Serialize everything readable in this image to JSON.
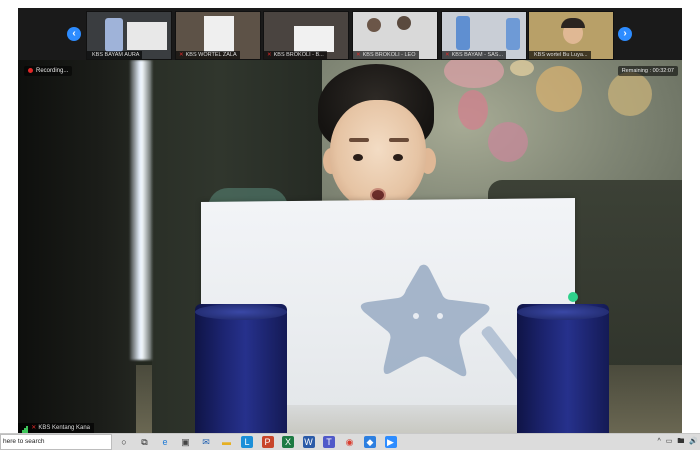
{
  "strip": {
    "prev_arrow": "‹",
    "next_arrow": "›",
    "thumbnails": [
      {
        "label": "KBS BAYAM AURA",
        "muted": false,
        "bg": "#3a3d40"
      },
      {
        "label": "KBS WORTEL ZALA",
        "muted": true,
        "bg": "#5d5247"
      },
      {
        "label": "KBS BROKOLI - B...",
        "muted": true,
        "bg": "#4a4440"
      },
      {
        "label": "KBS BROKOLI - LEO",
        "muted": true,
        "bg": "#d9d9d9"
      },
      {
        "label": "KBS BAYAM - SAS...",
        "muted": true,
        "bg": "#c9ced6"
      },
      {
        "label": "KBS wortel Bu Luya...",
        "muted": false,
        "bg": "#b8a068"
      }
    ]
  },
  "overlays": {
    "recording_label": "Recording...",
    "remaining_label": "Remaining : 00:32:07",
    "speaker_name": "KBS Kentang Kana"
  },
  "taskbar": {
    "search_text": "here to search",
    "icons": [
      {
        "name": "cortana-icon",
        "glyph": "○",
        "color": "#222"
      },
      {
        "name": "task-view-icon",
        "glyph": "⧉",
        "color": "#222"
      },
      {
        "name": "edge-icon",
        "glyph": "e",
        "color": "#1f7bd6"
      },
      {
        "name": "store-icon",
        "glyph": "▣",
        "color": "#444"
      },
      {
        "name": "mail-icon",
        "glyph": "✉",
        "color": "#1f5fb0"
      },
      {
        "name": "file-explorer-icon",
        "glyph": "▬",
        "color": "#e6b022"
      },
      {
        "name": "app-l-icon",
        "glyph": "L",
        "color": "#fff"
      },
      {
        "name": "powerpoint-icon",
        "glyph": "P",
        "color": "#fff"
      },
      {
        "name": "excel-icon",
        "glyph": "X",
        "color": "#fff"
      },
      {
        "name": "word-icon",
        "glyph": "W",
        "color": "#fff"
      },
      {
        "name": "teams-icon",
        "glyph": "T",
        "color": "#fff"
      },
      {
        "name": "chrome-icon",
        "glyph": "◉",
        "color": "#d93c2e"
      },
      {
        "name": "dropbox-icon",
        "glyph": "◆",
        "color": "#fff"
      },
      {
        "name": "zoom-icon",
        "glyph": "▶",
        "color": "#fff"
      }
    ],
    "tray": [
      "^",
      "▭",
      "🖿",
      "🔊"
    ]
  }
}
